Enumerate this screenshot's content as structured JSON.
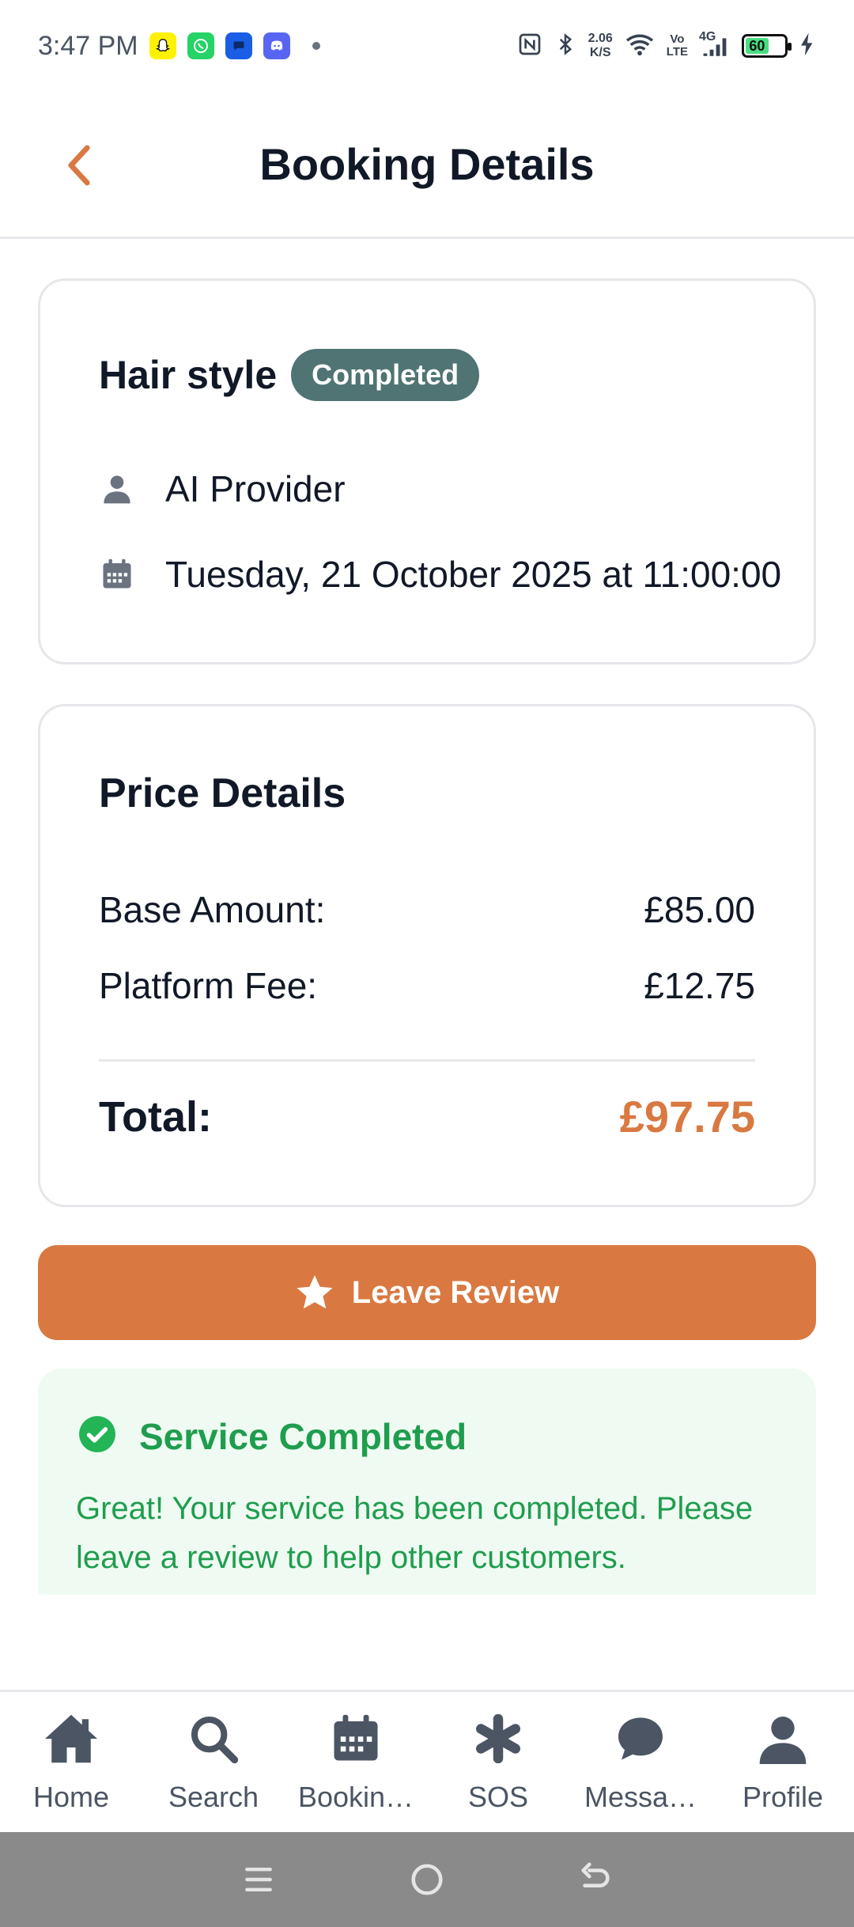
{
  "status_bar": {
    "time": "3:47 PM",
    "net_speed_value": "2.06",
    "net_speed_unit": "K/S",
    "volte_top": "Vo",
    "volte_bottom": "LTE",
    "signal_label": "4G",
    "battery_level": "60",
    "icons": [
      "snapchat-icon",
      "whatsapp-icon",
      "messages-icon",
      "discord-icon",
      "nfc-icon",
      "bluetooth-icon",
      "wifi-icon",
      "signal-icon",
      "battery-icon",
      "charging-icon"
    ]
  },
  "header": {
    "title": "Booking Details",
    "back_icon": "chevron-left-icon"
  },
  "booking": {
    "service_name": "Hair style",
    "status": "Completed",
    "provider": "AI Provider",
    "datetime": "Tuesday, 21 October 2025 at 11:00:00"
  },
  "price": {
    "title": "Price Details",
    "base_label": "Base Amount:",
    "base_value": "£85.00",
    "fee_label": "Platform Fee:",
    "fee_value": "£12.75",
    "total_label": "Total:",
    "total_value": "£97.75"
  },
  "actions": {
    "review_label": "Leave Review"
  },
  "notice": {
    "title": "Service Completed",
    "message": "Great! Your service has been completed. Please leave a review to help other customers."
  },
  "nav": {
    "items": [
      {
        "label": "Home",
        "icon": "home-icon"
      },
      {
        "label": "Search",
        "icon": "search-icon"
      },
      {
        "label": "Bookin…",
        "icon": "calendar-icon"
      },
      {
        "label": "SOS",
        "icon": "asterisk-icon"
      },
      {
        "label": "Messa…",
        "icon": "chat-icon"
      },
      {
        "label": "Profile",
        "icon": "user-icon"
      }
    ]
  },
  "colors": {
    "accent": "#d97941",
    "badge": "#4f7473",
    "success": "#1f9d4e",
    "success_bg": "#effbf2"
  }
}
